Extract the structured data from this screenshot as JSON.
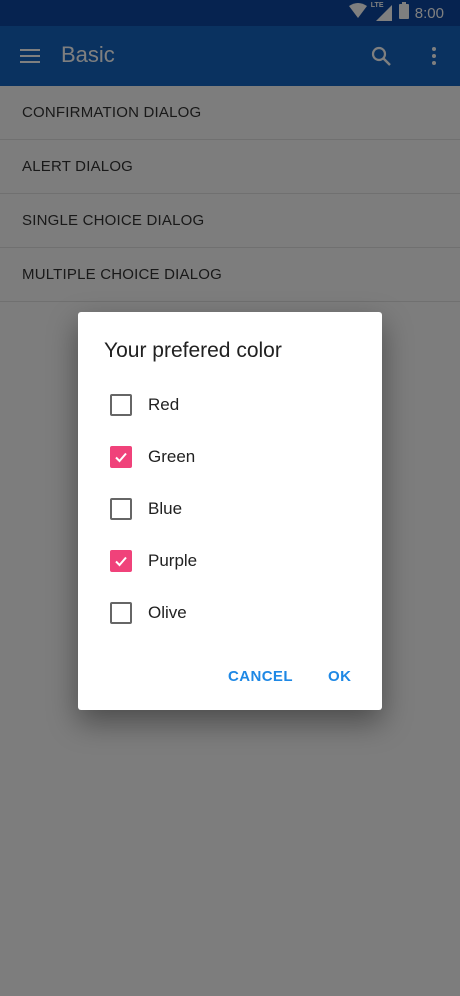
{
  "status_bar": {
    "time": "8:00",
    "icons": [
      "wifi-icon",
      "lte-signal-icon",
      "battery-icon"
    ],
    "network_label": "LTE"
  },
  "app_bar": {
    "title": "Basic",
    "icons": [
      "menu-icon",
      "search-icon",
      "more-vert-icon"
    ],
    "color": "#1565c0"
  },
  "list": {
    "items": [
      {
        "label": "CONFIRMATION DIALOG"
      },
      {
        "label": "ALERT DIALOG"
      },
      {
        "label": "SINGLE CHOICE DIALOG"
      },
      {
        "label": "MULTIPLE CHOICE DIALOG"
      }
    ]
  },
  "dialog": {
    "title": "Your prefered color",
    "options": [
      {
        "label": "Red",
        "checked": false
      },
      {
        "label": "Green",
        "checked": true
      },
      {
        "label": "Blue",
        "checked": false
      },
      {
        "label": "Purple",
        "checked": true
      },
      {
        "label": "Olive",
        "checked": false
      }
    ],
    "cancel_label": "CANCEL",
    "ok_label": "OK",
    "accent_color": "#f0427a",
    "button_color": "#1e88e5"
  }
}
